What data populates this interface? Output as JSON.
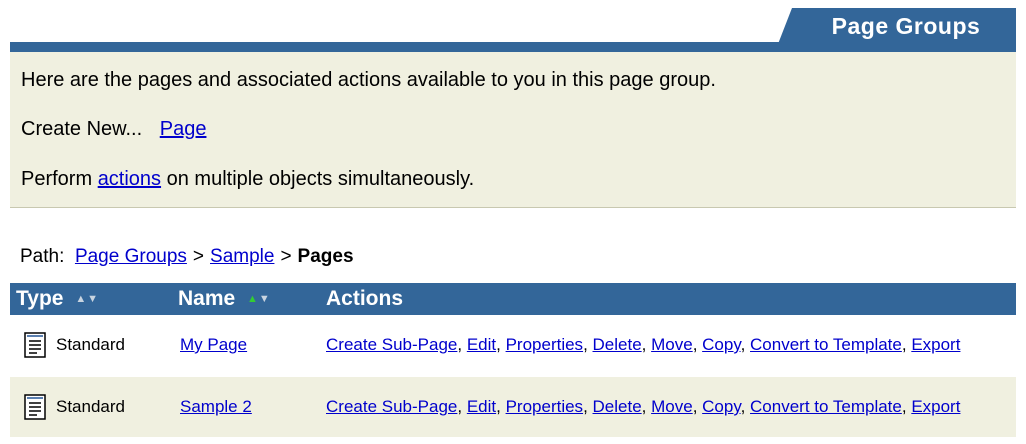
{
  "header": {
    "tab_label": "Page Groups"
  },
  "intro": {
    "description": "Here are the pages and associated actions available to you in this page group.",
    "create_label": "Create New...",
    "create_link": "Page",
    "perform_prefix": "Perform",
    "perform_link": "actions",
    "perform_suffix": "on multiple objects simultaneously."
  },
  "path": {
    "label": "Path:",
    "crumbs": [
      "Page Groups",
      "Sample"
    ],
    "separator": ">",
    "current": "Pages"
  },
  "table": {
    "columns": [
      "Type",
      "Name",
      "Actions"
    ],
    "rows": [
      {
        "type": "Standard",
        "name": "My Page",
        "actions": [
          "Create Sub-Page",
          "Edit",
          "Properties",
          "Delete",
          "Move",
          "Copy",
          "Convert to Template",
          "Export"
        ]
      },
      {
        "type": "Standard",
        "name": "Sample 2",
        "actions": [
          "Create Sub-Page",
          "Edit",
          "Properties",
          "Delete",
          "Move",
          "Copy",
          "Convert to Template",
          "Export"
        ]
      }
    ]
  },
  "icons": {
    "sort_up": "triangle-up-icon",
    "sort_down": "triangle-down-icon",
    "row_type": "document-icon"
  },
  "colors": {
    "header_blue": "#336699",
    "panel_beige": "#f0f0e0",
    "link_blue": "#0000cc",
    "sort_active": "#33cc33"
  }
}
